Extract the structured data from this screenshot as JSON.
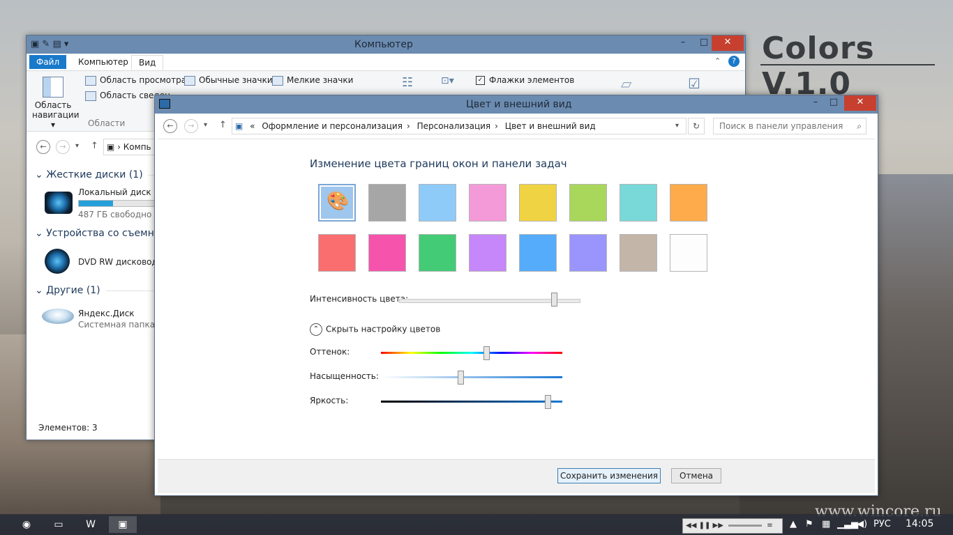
{
  "desktop": {
    "brand": "Colors V.1.0",
    "watermark": "www.wincore.ru"
  },
  "explorer": {
    "title": "Компьютер",
    "tabs": [
      "Файл",
      "Компьютер",
      "Вид"
    ],
    "ribbon": {
      "nav_pane": "Область навигации",
      "preview_pane": "Область просмотра",
      "details_pane": "Область сведен",
      "group_label": "Области",
      "normal_icons": "Обычные значки",
      "small_icons": "Мелкие значки",
      "item_checkboxes": "Флажки элементов"
    },
    "address": "Компь",
    "groups": {
      "hdd": "Жесткие диски (1)",
      "removable": "Устройства со съемны",
      "other": "Другие (1)"
    },
    "items": {
      "local_disk": {
        "name": "Локальный диск (C:",
        "free": "487 ГБ свободно из",
        "used": 0.45
      },
      "dvd": {
        "name": "DVD RW дисковод (D"
      },
      "yandex": {
        "name": "Яндекс.Диск",
        "sub": "Системная папка"
      }
    },
    "status": "Элементов: 3"
  },
  "cp": {
    "title": "Цвет и внешний вид",
    "breadcrumb": {
      "prefix": "«",
      "items": [
        "Оформление и персонализация",
        "Персонализация",
        "Цвет и внешний вид"
      ]
    },
    "search_placeholder": "Поиск в панели управления",
    "heading": "Изменение цвета границ окон и панели задач",
    "swatches": [
      {
        "name": "custom",
        "color": "#9fc6ec"
      },
      {
        "name": "gray",
        "color": "#a6a6a6"
      },
      {
        "name": "sky",
        "color": "#8ecbf9"
      },
      {
        "name": "pink",
        "color": "#f59ad8"
      },
      {
        "name": "yellow",
        "color": "#f0d342"
      },
      {
        "name": "green",
        "color": "#a9d75b"
      },
      {
        "name": "teal",
        "color": "#79d8d8"
      },
      {
        "name": "orange",
        "color": "#fdab4b"
      },
      {
        "name": "red",
        "color": "#fb6e70"
      },
      {
        "name": "magenta",
        "color": "#f653ad"
      },
      {
        "name": "emerald",
        "color": "#43cb76"
      },
      {
        "name": "violet",
        "color": "#c587f9"
      },
      {
        "name": "blue",
        "color": "#55acfb"
      },
      {
        "name": "periwinkle",
        "color": "#9995fd"
      },
      {
        "name": "taupe",
        "color": "#c3b5a8"
      },
      {
        "name": "white",
        "color": "#fdfdfd"
      }
    ],
    "selected_swatch": 0,
    "intensity_label": "Интенсивность цвета:",
    "intensity": 0.86,
    "toggle_label": "Скрыть настройку цветов",
    "hue_label": "Оттенок:",
    "hue": 0.58,
    "saturation_label": "Насыщенность:",
    "saturation": 0.44,
    "brightness_label": "Яркость:",
    "brightness": 0.92,
    "save_label": "Сохранить изменения",
    "cancel_label": "Отмена"
  },
  "taskbar": {
    "lang": "РУС",
    "time": "14:05"
  }
}
